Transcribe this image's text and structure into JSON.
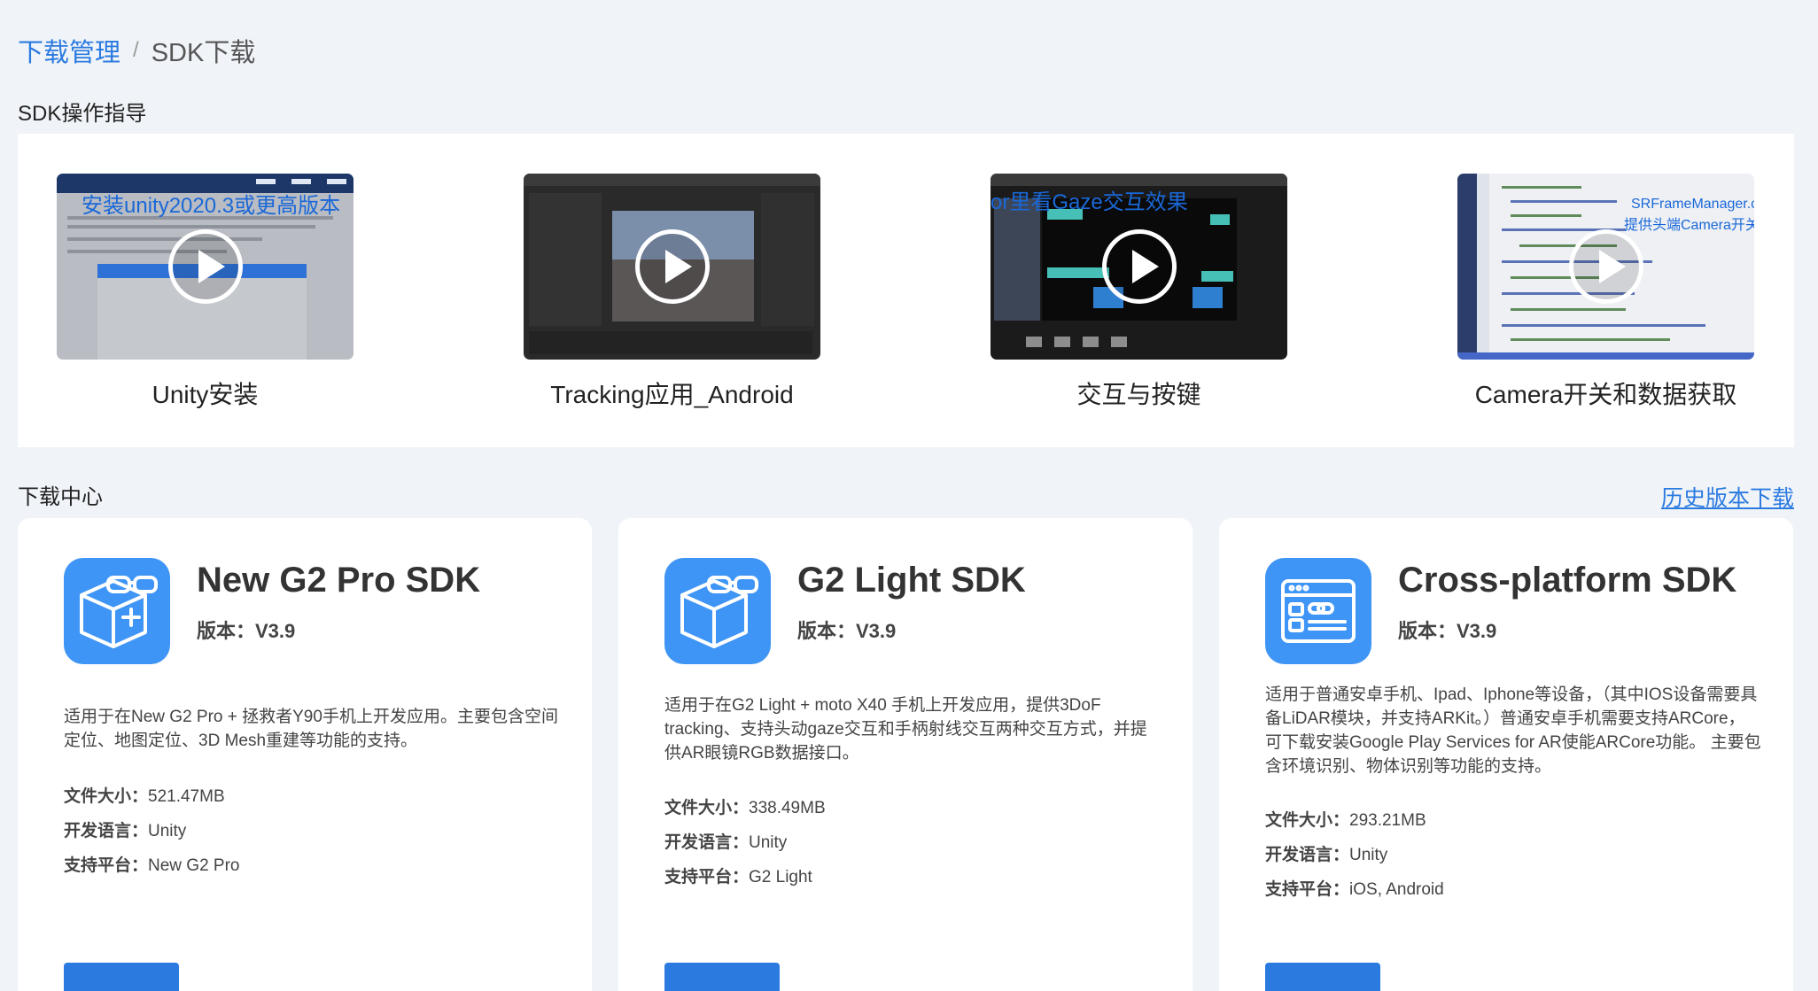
{
  "breadcrumb": {
    "parent": "下载管理",
    "separator": "/",
    "current": "SDK下载"
  },
  "guide": {
    "title": "SDK操作指导",
    "videos": [
      {
        "caption": "Unity安装",
        "overlay": "安装unity2020.3或更高版本",
        "icon": "play-icon"
      },
      {
        "caption": "Tracking应用_Android",
        "overlay": "",
        "icon": "play-icon"
      },
      {
        "caption": "交互与按键",
        "overlay": "or里看Gaze交互效果",
        "icon": "play-icon"
      },
      {
        "caption": "Camera开关和数据获取",
        "overlay": "SRFrameManager.c",
        "overlay2": "提供头端Camera开关",
        "icon": "play-icon"
      }
    ]
  },
  "downloads": {
    "title": "下载中心",
    "history_link": "历史版本下载",
    "cards": [
      {
        "icon": "ar-glasses-cube-plus-icon",
        "title": "New G2 Pro SDK",
        "version": "版本：V3.9",
        "description": "适用于在New G2 Pro + 拯救者Y90手机上开发应用。主要包含空间定位、地图定位、3D Mesh重建等功能的支持。",
        "size_label": "文件大小：",
        "size": "521.47MB",
        "lang_label": "开发语言：",
        "lang": "Unity",
        "platform_label": "支持平台：",
        "platform": "New G2 Pro"
      },
      {
        "icon": "ar-glasses-cube-icon",
        "title": "G2 Light SDK",
        "version": "版本：V3.9",
        "description": "适用于在G2 Light + moto X40 手机上开发应用，提供3DoF tracking、支持头动gaze交互和手柄射线交互两种交互方式，并提供AR眼镜RGB数据接口。",
        "size_label": "文件大小：",
        "size": "338.49MB",
        "lang_label": "开发语言：",
        "lang": "Unity",
        "platform_label": "支持平台：",
        "platform": "G2 Light"
      },
      {
        "icon": "browser-window-icon",
        "title": "Cross-platform SDK",
        "version": "版本：V3.9",
        "description": "适用于普通安卓手机、Ipad、Iphone等设备，（其中IOS设备需要具备LiDAR模块，并支持ARKit。）普通安卓手机需要支持ARCore，可下载安装Google Play Services for AR使能ARCore功能。 主要包含环境识别、物体识别等功能的支持。",
        "size_label": "文件大小：",
        "size": "293.21MB",
        "lang_label": "开发语言：",
        "lang": "Unity",
        "platform_label": "支持平台：",
        "platform": "iOS, Android"
      }
    ]
  },
  "colors": {
    "accent": "#2b7ae0",
    "icon_bg": "#3f95f5",
    "page_bg": "#f0f4f8"
  }
}
